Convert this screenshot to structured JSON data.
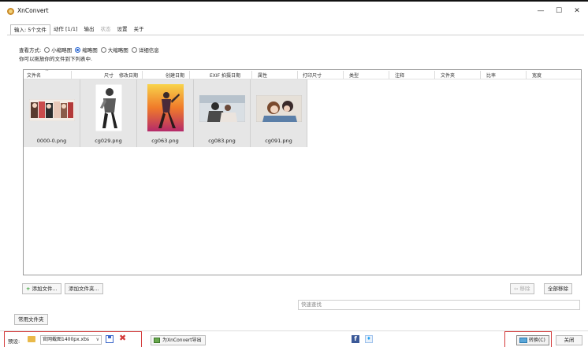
{
  "window": {
    "title": "XnConvert"
  },
  "window_controls": {
    "minimize": "—",
    "maximize": "☐",
    "close": "✕"
  },
  "tabs": [
    {
      "label": "输入: 5个文件",
      "state": "active"
    },
    {
      "label": "动作 [1/1]",
      "state": "normal"
    },
    {
      "label": "输出",
      "state": "normal"
    },
    {
      "label": "状态",
      "state": "disabled"
    },
    {
      "label": "设置",
      "state": "normal"
    },
    {
      "label": "关于",
      "state": "normal"
    }
  ],
  "view": {
    "label": "查看方式:",
    "options": [
      {
        "label": "小缩略图",
        "checked": false
      },
      {
        "label": "缩略图",
        "checked": true
      },
      {
        "label": "大缩略图",
        "checked": false
      },
      {
        "label": "详细信息",
        "checked": false
      }
    ],
    "drag_hint": "你可以拖放你的文件到下列表中."
  },
  "columns": [
    "文件名",
    "尺寸",
    "修改日期",
    "创建日期",
    "EXIF 拍摄日期",
    "属性",
    "打印尺寸",
    "类型",
    "注释",
    "文件夹",
    "比率",
    "宽度"
  ],
  "files": [
    {
      "name": "0000-0.png",
      "thumb": "group-collage"
    },
    {
      "name": "cg029.png",
      "thumb": "standing-figure"
    },
    {
      "name": "cg063.png",
      "thumb": "fire-dance"
    },
    {
      "name": "cg083.png",
      "thumb": "couple-indoors"
    },
    {
      "name": "cg091.png",
      "thumb": "close-up"
    }
  ],
  "panel_buttons": {
    "add_files": "添加文件...",
    "add_folder": "添加文件夹...",
    "remove": "移除",
    "remove_all": "全部移除",
    "common_folders": "常用文件夹"
  },
  "quick_search": {
    "placeholder": "快速查找"
  },
  "status_bar": {
    "preset_label": "预设:",
    "preset_value": "官网截图1400px.xbs",
    "export_label": "为XnConvert导出",
    "convert_label": "转换(C)",
    "close_label": "关闭"
  },
  "colors": {
    "highlight_red": "#d43a3a",
    "accent_blue": "#1f5fd0",
    "thumb_bg": "#e6e6e6"
  }
}
